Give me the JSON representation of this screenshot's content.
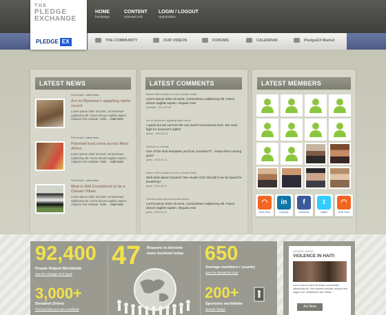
{
  "logo": {
    "line1": "THE",
    "line2": "PLEDGE",
    "line3": "EXCHANGE",
    "brand_a": "PLEDGE",
    "brand_b": "EX"
  },
  "topnav": [
    {
      "label": "HOME",
      "sub": "frontpage"
    },
    {
      "label": "CONTENT",
      "sub": "relevant info"
    },
    {
      "label": "LOGIN / LOGOUT",
      "sub": "registration"
    }
  ],
  "subnav": [
    {
      "label": "THE COMMUNITY",
      "icon": "community-icon"
    },
    {
      "label": "OUR VIDEOS",
      "icon": "video-icon"
    },
    {
      "label": "FORUMS",
      "icon": "forum-icon"
    },
    {
      "label": "CALENDAR",
      "icon": "calendar-icon"
    },
    {
      "label": "PledgeEX Market",
      "icon": "tag-icon"
    }
  ],
  "latest_news": {
    "heading": "LATEST NEWS",
    "items": [
      {
        "filed": "Filed Under: Latest News",
        "title": "Act on Myanmar's appalling rights record",
        "body": "Lorem ipsum dolor sit amet, consectetuer adipiscing elit. Fusce dictum sagittis sapien. Aliquam erat volutpat. Nulla ...",
        "more": "read more"
      },
      {
        "filed": "Filed Under: Latest News",
        "title": "Potential food crisis across West Africa",
        "body": "Lorem ipsum dolor sit amet, consectetuer adipiscing elit. Fusce dictum sagittis sapien. Aliquam erat volutpat. Nulla ...",
        "more": "read more"
      },
      {
        "filed": "Filed Under: Latest News",
        "title": "Meat is Still Considered to be a Climate Villain",
        "body": "Lorem ipsum dolor sit amet, consectetuer adipiscing elit. Fusce dictum sagittis sapien. Aliquam erat volutpat. Nulla ...",
        "more": "read more"
      }
    ]
  },
  "latest_comments": {
    "heading": "LATEST COMMENTS",
    "items": [
      {
        "topic": "Meat is Still Considered to be a Climate Villain",
        "body": "Lorem ipsum dolor sit amet, consectetuer adipiscing elit. Fusce dictum sagittis sapien. Aliquam erat",
        "by": "joomlakit - 2010-03-28"
      },
      {
        "topic": "Act on Myanmar's appalling rights record",
        "body": "I agree but we can't let the one world Government form. We must fight for everone's rights!",
        "by": "jaxhex - 2010-04-11"
      },
      {
        "topic": "Welcome to Joomla!",
        "body": "One of the best templates yet from JoomlaXTC - Keep them coming guys!",
        "by": "guest - 2010-04-11"
      },
      {
        "topic": "Meat is Still Considered to be a Climate Villain",
        "body": "Well what about humans? We emaile CO2 shouldn't we be taxed for breathing?",
        "by": "guest - 2010-04-11"
      },
      {
        "topic": "Potential food crisis across West Africa",
        "body": "Lorem ipsum dolor sit amet, consectetuer adipiscing elit. Fusce dictum sagittis sapien. Aliquam erat",
        "by": "guest - 2010-04-11"
      }
    ]
  },
  "latest_members": {
    "heading": "LATEST MEMBERS",
    "social": [
      {
        "icon": "rss-icon",
        "label": "RSS Feed",
        "glyph": "◠",
        "color": "#f26522"
      },
      {
        "icon": "linkedin-icon",
        "label": "LinkedIn",
        "glyph": "in",
        "color": "#0e76a8"
      },
      {
        "icon": "facebook-icon",
        "label": "Facebook",
        "glyph": "f",
        "color": "#3b5998"
      },
      {
        "icon": "twitter-icon",
        "label": "Twitter",
        "glyph": "t",
        "color": "#33ccff"
      },
      {
        "icon": "rss-icon",
        "label": "RSS Feed",
        "glyph": "◠",
        "color": "#f26522"
      }
    ]
  },
  "stats": {
    "s1_value": "92,400",
    "s1_label": "People Helped Worldwide",
    "s1_link": "See the changes first hand",
    "s2_value": "3,000+",
    "s2_label": "Donation Drives",
    "s2_link": "Find out how you can contribute",
    "s3_value": "47",
    "s3_label_a": "Reasons to become",
    "s3_label_b": "more involved today",
    "s4_value": "650",
    "s4_label": "Average members / country",
    "s4_link": "See the interactive map",
    "s5_value": "200+",
    "s5_label": "Sponsors worldwide",
    "s5_link": "Donate Today!"
  },
  "urgent": {
    "kicker": "URGENT NEWS",
    "headline": "VIOLENCE IN HAITI",
    "body": "Lorem ipsum dolor sit amet, consectetur adipiscing elit. Sed laoreet suscipit, tempor sed augue est. Vestibulum sem tellus ...",
    "button": "Act Now"
  }
}
